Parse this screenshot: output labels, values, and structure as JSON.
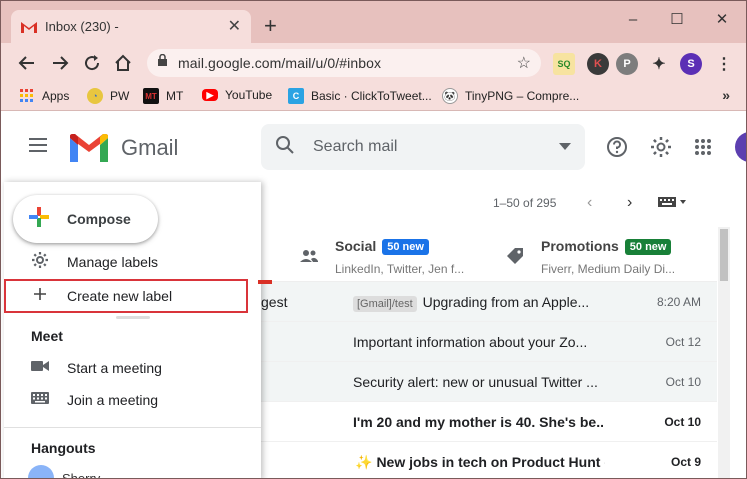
{
  "browser": {
    "tab_title": "Inbox (230) -",
    "new_tab_icon": "plus-icon",
    "url": "mail.google.com/mail/u/0/#inbox",
    "profile_letter": "S",
    "window_controls": [
      "minimize",
      "maximize",
      "close"
    ]
  },
  "bookmarks": [
    {
      "label": "Apps",
      "icon": "apps-grid-icon"
    },
    {
      "label": "PW",
      "icon": "pw-icon"
    },
    {
      "label": "MT",
      "icon": "mt-icon"
    },
    {
      "label": "YouTube",
      "icon": "youtube-icon"
    },
    {
      "label": "Basic · ClickToTweet...",
      "icon": "clicktotweet-icon"
    },
    {
      "label": "TinyPNG – Compre...",
      "icon": "tinypng-icon"
    }
  ],
  "gmail": {
    "brand": "Gmail",
    "search_placeholder": "Search mail",
    "pager_text": "1–50 of 295"
  },
  "sidebar": {
    "compose_label": "Compose",
    "items": [
      {
        "label": "Manage labels",
        "icon": "gear-icon"
      },
      {
        "label": "Create new label",
        "icon": "plus-icon"
      }
    ],
    "meet_title": "Meet",
    "meet_items": [
      {
        "label": "Start a meeting",
        "icon": "video-icon"
      },
      {
        "label": "Join a meeting",
        "icon": "keyboard-icon"
      }
    ],
    "hangouts_title": "Hangouts",
    "hangouts_user": "Sherry –"
  },
  "categories": [
    {
      "name": "Social",
      "badge": "50 new",
      "badge_color": "#1a73e8",
      "sub": "LinkedIn, Twitter, Jen f..."
    },
    {
      "name": "Promotions",
      "badge": "50 new",
      "badge_color": "#188038",
      "sub": "Fiverr, Medium Daily Di..."
    }
  ],
  "mails": [
    {
      "prefix": "gest",
      "chip": "[Gmail]/test",
      "subject": "Upgrading from an Apple...",
      "date": "8:20 AM",
      "bold": false,
      "read": true
    },
    {
      "prefix": "",
      "chip": "",
      "subject": "Important information about your Zo...",
      "date": "Oct 12",
      "bold": false,
      "read": true
    },
    {
      "prefix": "",
      "chip": "",
      "subject": "Security alert: new or unusual Twitter ...",
      "date": "Oct 10",
      "bold": false,
      "read": true
    },
    {
      "prefix": "",
      "chip": "",
      "subject": "I'm 20 and my mother is 40. She's be...",
      "date": "Oct 10",
      "bold": true,
      "read": false
    },
    {
      "prefix": "",
      "chip": "",
      "subject": "New jobs in tech on Product Hunt -",
      "date": "Oct 9",
      "bold": true,
      "read": false
    }
  ]
}
